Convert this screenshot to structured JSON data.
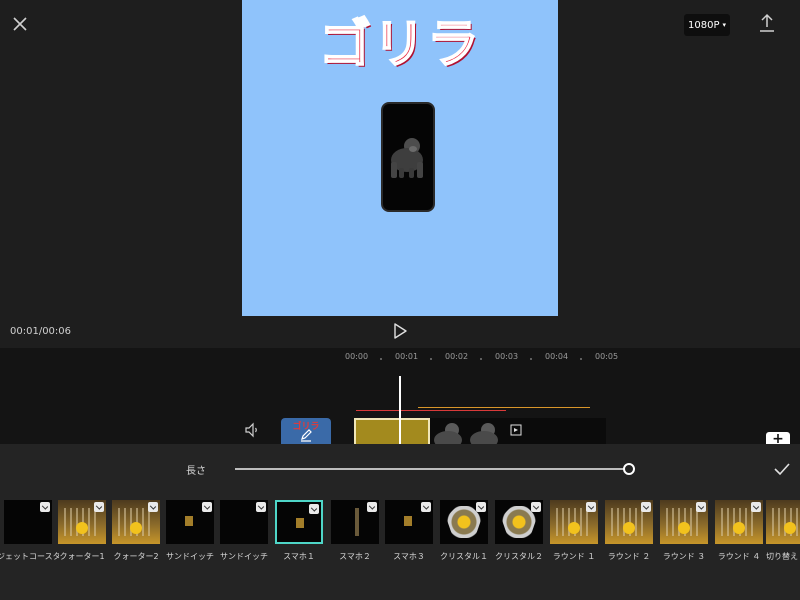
{
  "header": {
    "resolution_label": "1080P",
    "resolution_caret": "▾"
  },
  "preview": {
    "title_text": "ゴリラ"
  },
  "player": {
    "timecode": "00:01/00:06"
  },
  "timeline": {
    "ruler_labels": [
      "00:00",
      "00:01",
      "00:02",
      "00:03",
      "00:04",
      "00:05"
    ],
    "cover_title": "ゴリラ",
    "add_label": "+"
  },
  "panel": {
    "length_label": "長さ",
    "length_value": 1.0
  },
  "effects": [
    {
      "label": "ジェットコースター",
      "thumb": "dark"
    },
    {
      "label": "クォーター1",
      "thumb": "scene"
    },
    {
      "label": "クォーター2",
      "thumb": "scene"
    },
    {
      "label": "サンドイッチ",
      "thumb": "small"
    },
    {
      "label": "サンドイッチ",
      "thumb": "dark"
    },
    {
      "label": "スマホ１",
      "thumb": "small",
      "selected": true
    },
    {
      "label": "スマホ２",
      "thumb": "slab"
    },
    {
      "label": "スマホ３",
      "thumb": "small"
    },
    {
      "label": "クリスタル１",
      "thumb": "crystal"
    },
    {
      "label": "クリスタル２",
      "thumb": "crystal"
    },
    {
      "label": "ラウンド １",
      "thumb": "scene"
    },
    {
      "label": "ラウンド ２",
      "thumb": "scene"
    },
    {
      "label": "ラウンド ３",
      "thumb": "scene"
    },
    {
      "label": "ラウンド ４",
      "thumb": "scene"
    },
    {
      "label": "切り替え",
      "thumb": "scene"
    }
  ],
  "colors": {
    "preview_bg": "#8fc3fb",
    "title_red": "#e8233c",
    "selected_border": "#4fd6c8",
    "clip_gold": "#a38a1e"
  }
}
